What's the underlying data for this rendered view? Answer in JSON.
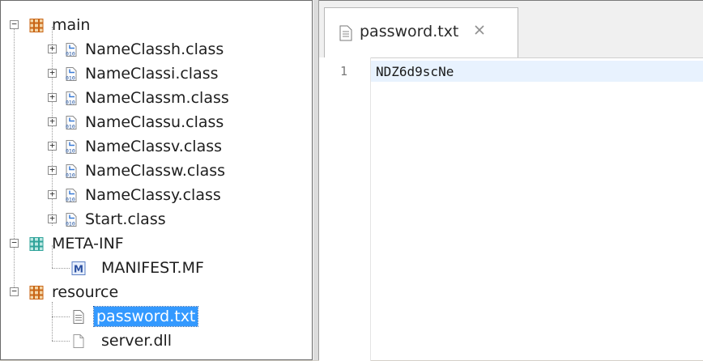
{
  "tree": {
    "items": [
      {
        "label": "main",
        "icon": "package-icon"
      },
      {
        "label": "NameClassh.class",
        "icon": "class-file-icon"
      },
      {
        "label": "NameClassi.class",
        "icon": "class-file-icon"
      },
      {
        "label": "NameClassm.class",
        "icon": "class-file-icon"
      },
      {
        "label": "NameClassu.class",
        "icon": "class-file-icon"
      },
      {
        "label": "NameClassv.class",
        "icon": "class-file-icon"
      },
      {
        "label": "NameClassw.class",
        "icon": "class-file-icon"
      },
      {
        "label": "NameClassy.class",
        "icon": "class-file-icon"
      },
      {
        "label": "Start.class",
        "icon": "class-file-icon"
      },
      {
        "label": "META-INF",
        "icon": "meta-folder-icon"
      },
      {
        "label": "MANIFEST.MF",
        "icon": "manifest-icon"
      },
      {
        "label": "resource",
        "icon": "package-icon"
      },
      {
        "label": "password.txt",
        "icon": "text-file-icon",
        "selected": true
      },
      {
        "label": "server.dll",
        "icon": "blank-file-icon"
      }
    ]
  },
  "editor": {
    "tab": {
      "title": "password.txt",
      "icon": "text-file-icon",
      "close_icon": "close-icon"
    },
    "lines": [
      {
        "number": "1",
        "text": "NDZ6d9scNe"
      }
    ]
  },
  "colors": {
    "selection": "#3399ff",
    "current_line": "#e8f2fe",
    "package": "#c86414",
    "meta_folder": "#2fa39a"
  }
}
